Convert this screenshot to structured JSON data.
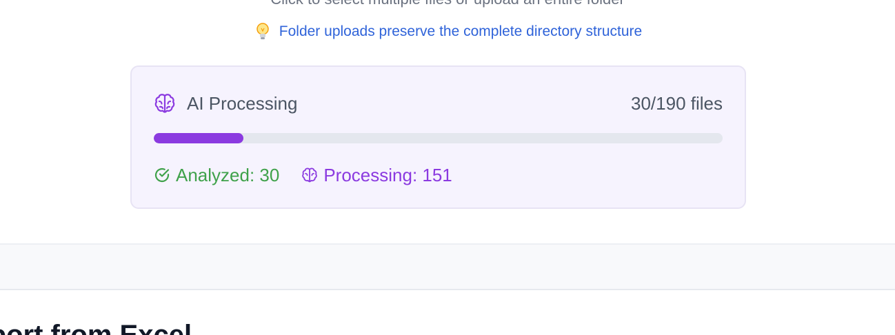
{
  "upload": {
    "subtitle": "Click to select multiple files or upload an entire folder",
    "tip_text": "Folder uploads preserve the complete directory structure",
    "tip_icon": "lightbulb-icon"
  },
  "ai_processing": {
    "title": "AI Processing",
    "title_icon": "brain-icon",
    "file_count": "30/190 files",
    "progress_fraction": 0.158,
    "analyzed_label": "Analyzed: 30",
    "analyzed_icon": "check-circle-icon",
    "processing_label": "Processing: 151",
    "processing_icon": "brain-icon",
    "colors": {
      "accent": "#8b3ae0",
      "success": "#3fa14a",
      "card_bg": "#f6f3fe"
    }
  },
  "import_section": {
    "title": "Import from Excel"
  }
}
